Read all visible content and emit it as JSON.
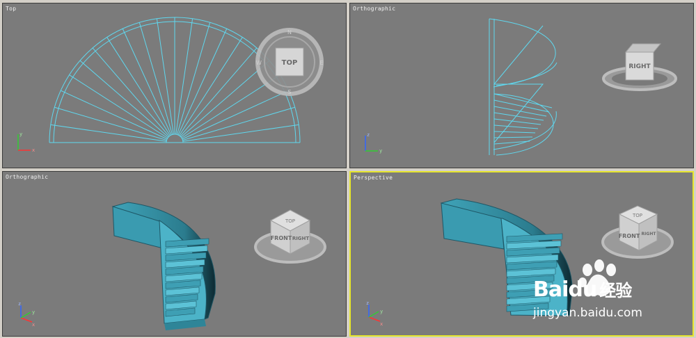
{
  "viewports": {
    "top_left": {
      "label": "Top",
      "cube_face": "TOP",
      "compass": [
        "N",
        "W",
        "E",
        "S"
      ]
    },
    "top_right": {
      "label": "Orthographic",
      "cube_face": "RIGHT"
    },
    "bottom_left": {
      "label": "Orthographic",
      "cube_faces": [
        "TOP",
        "FRONT",
        "RIGHT"
      ]
    },
    "bottom_right": {
      "label": "Perspective",
      "cube_faces": [
        "TOP",
        "FRONT",
        "RIGHT"
      ]
    }
  },
  "axes": {
    "x": "x",
    "y": "y",
    "z": "z"
  },
  "watermark": {
    "brand": "Baidu",
    "product": "经验",
    "url": "jingyan.baidu.com"
  },
  "colors": {
    "viewport_bg": "#7b7b7b",
    "wireframe": "#5fd8ef",
    "stair": "#3fa3b8",
    "active_border": "#e6e62c"
  }
}
